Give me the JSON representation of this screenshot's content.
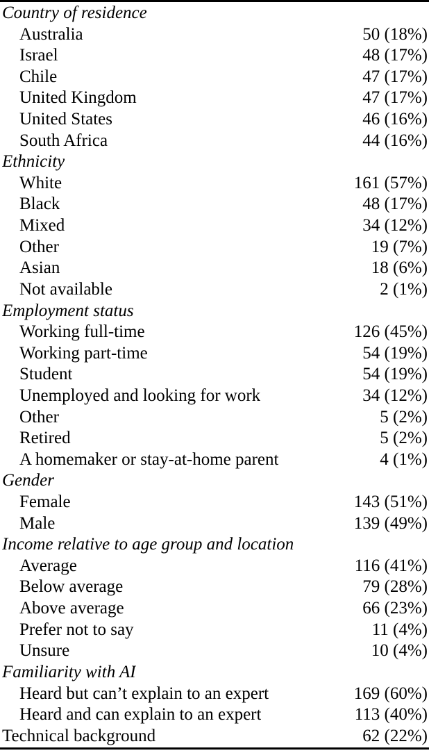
{
  "table": {
    "rules": {
      "top": true,
      "bottom": true
    },
    "rows": [
      {
        "type": "section",
        "label": "Country of residence",
        "value": ""
      },
      {
        "type": "item",
        "label": "Australia",
        "value": "50 (18%)"
      },
      {
        "type": "item",
        "label": "Israel",
        "value": "48 (17%)"
      },
      {
        "type": "item",
        "label": "Chile",
        "value": "47 (17%)"
      },
      {
        "type": "item",
        "label": "United Kingdom",
        "value": "47 (17%)"
      },
      {
        "type": "item",
        "label": "United States",
        "value": "46 (16%)"
      },
      {
        "type": "item",
        "label": "South Africa",
        "value": "44 (16%)"
      },
      {
        "type": "section",
        "label": "Ethnicity",
        "value": ""
      },
      {
        "type": "item",
        "label": "White",
        "value": "161 (57%)"
      },
      {
        "type": "item",
        "label": "Black",
        "value": "48 (17%)"
      },
      {
        "type": "item",
        "label": "Mixed",
        "value": "34 (12%)"
      },
      {
        "type": "item",
        "label": "Other",
        "value": "19 (7%)"
      },
      {
        "type": "item",
        "label": "Asian",
        "value": "18 (6%)"
      },
      {
        "type": "item",
        "label": "Not available",
        "value": "2 (1%)"
      },
      {
        "type": "section",
        "label": "Employment status",
        "value": ""
      },
      {
        "type": "item",
        "label": "Working full-time",
        "value": "126 (45%)"
      },
      {
        "type": "item",
        "label": "Working part-time",
        "value": "54 (19%)"
      },
      {
        "type": "item",
        "label": "Student",
        "value": "54 (19%)"
      },
      {
        "type": "item",
        "label": "Unemployed and looking for work",
        "value": "34 (12%)"
      },
      {
        "type": "item",
        "label": "Other",
        "value": "5 (2%)"
      },
      {
        "type": "item",
        "label": "Retired",
        "value": "5 (2%)"
      },
      {
        "type": "item",
        "label": "A homemaker or stay-at-home parent",
        "value": "4 (1%)"
      },
      {
        "type": "section",
        "label": "Gender",
        "value": ""
      },
      {
        "type": "item",
        "label": "Female",
        "value": "143 (51%)"
      },
      {
        "type": "item",
        "label": "Male",
        "value": "139 (49%)"
      },
      {
        "type": "section",
        "label": "Income relative to age group and location",
        "value": ""
      },
      {
        "type": "item",
        "label": "Average",
        "value": "116 (41%)"
      },
      {
        "type": "item",
        "label": "Below average",
        "value": "79 (28%)"
      },
      {
        "type": "item",
        "label": "Above average",
        "value": "66 (23%)"
      },
      {
        "type": "item",
        "label": "Prefer not to say",
        "value": "11 (4%)"
      },
      {
        "type": "item",
        "label": "Unsure",
        "value": "10 (4%)"
      },
      {
        "type": "section",
        "label": "Familiarity with AI",
        "value": ""
      },
      {
        "type": "item",
        "label": "Heard but can’t explain to an expert",
        "value": "169 (60%)"
      },
      {
        "type": "item",
        "label": "Heard and can explain to an expert",
        "value": "113 (40%)"
      },
      {
        "type": "total",
        "label": "Technical background",
        "value": "62 (22%)"
      }
    ]
  }
}
